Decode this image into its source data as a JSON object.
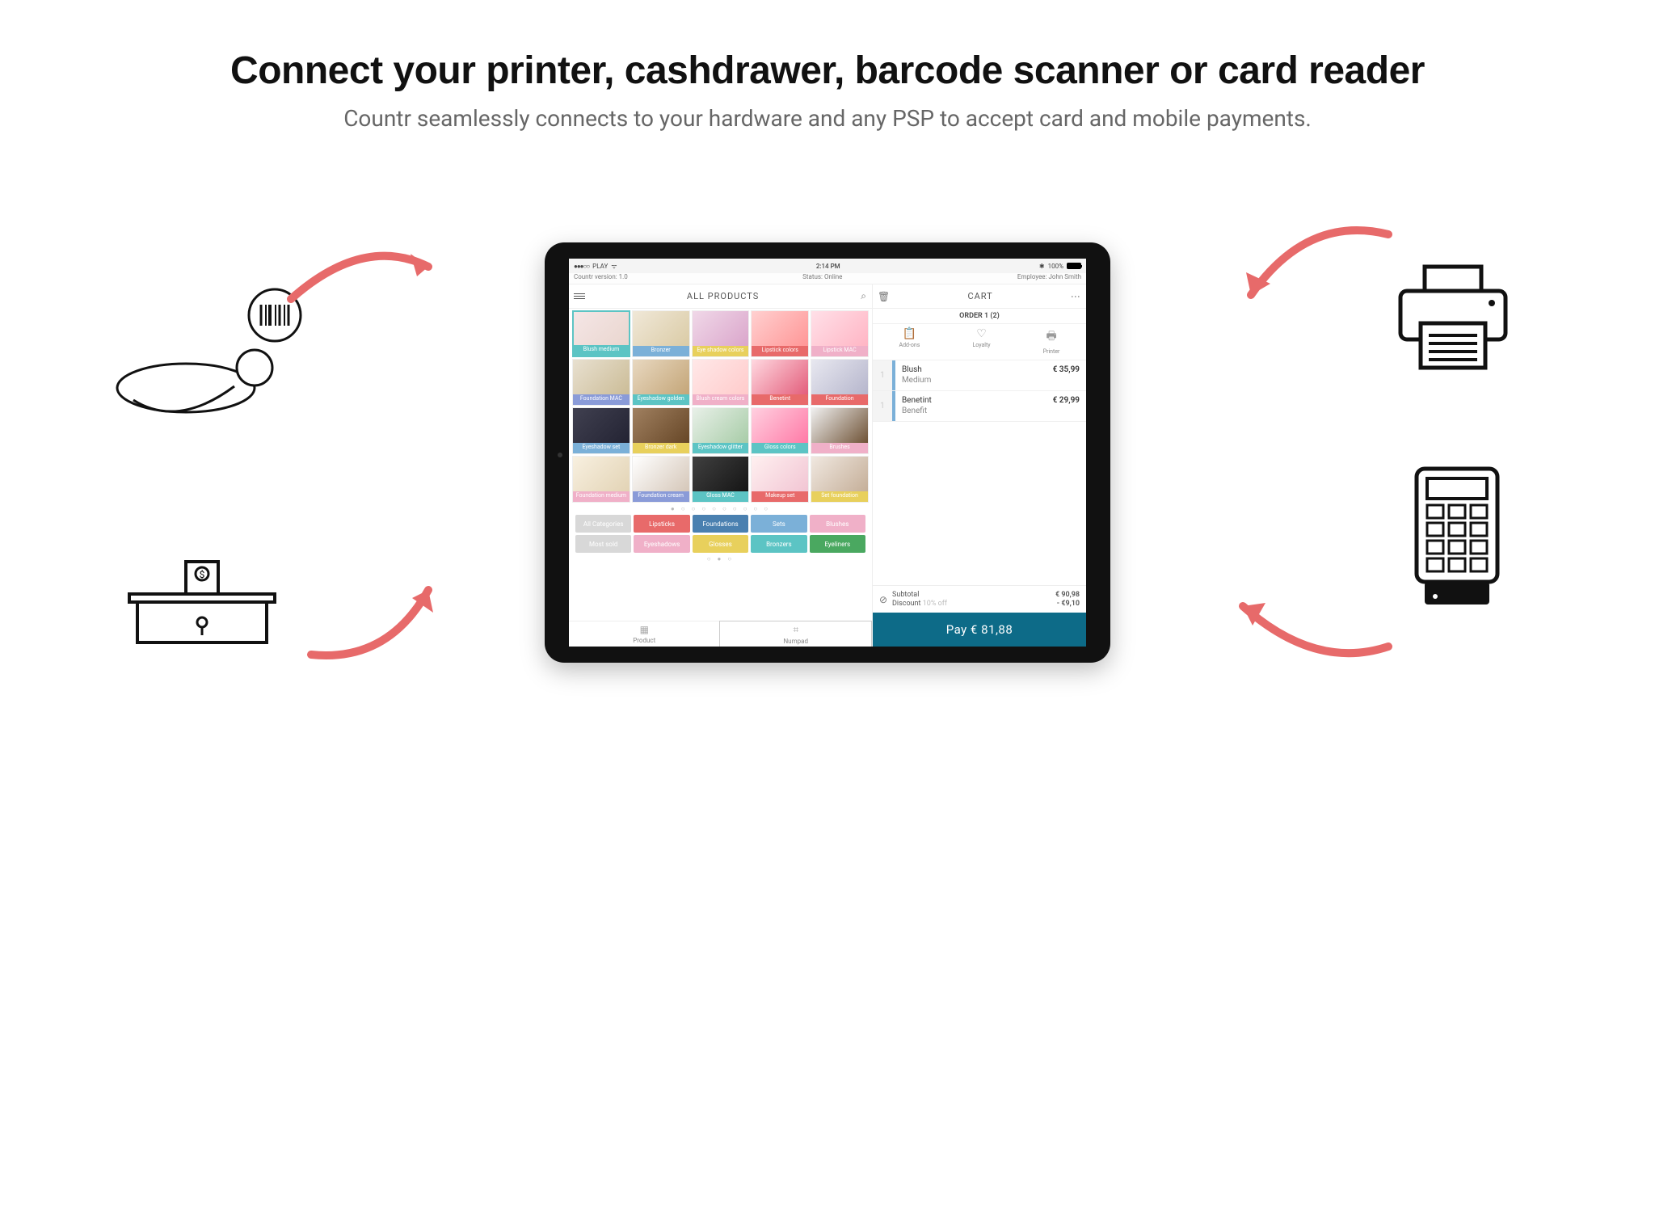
{
  "page": {
    "title": "Connect your printer, cashdrawer, barcode scanner or card reader",
    "subtitle": "Countr seamlessly connects to your hardware and any PSP to accept card and mobile payments."
  },
  "status_bar": {
    "carrier_dots": "●●●○○",
    "carrier": "PLAY",
    "time": "2:14 PM",
    "bluetooth": "✱",
    "battery_pct": "100%"
  },
  "info_bar": {
    "version": "Countr version: 1.0",
    "status": "Status: Online",
    "employee": "Employee: John Smith"
  },
  "left": {
    "header": "ALL PRODUCTS",
    "pager_dots": "● ○ ○ ○ ○ ○ ○ ○ ○ ○",
    "cat_dots": "○ ● ○"
  },
  "products": [
    {
      "name": "Blush medium",
      "color": "#5cc4c4",
      "img": "p1",
      "selected": true
    },
    {
      "name": "Bronzer",
      "color": "#7bb0d8",
      "img": "p2"
    },
    {
      "name": "Eye shadow colors",
      "color": "#e8d05c",
      "img": "p3"
    },
    {
      "name": "Lipstick colors",
      "color": "#e86a6a",
      "img": "p4"
    },
    {
      "name": "Lipstick MAC",
      "color": "#f0b0c8",
      "img": "p5"
    },
    {
      "name": "Foundation MAC",
      "color": "#8a9bd8",
      "img": "p6"
    },
    {
      "name": "Eyeshadow golden",
      "color": "#5cc4c4",
      "img": "p7"
    },
    {
      "name": "Blush cream colors",
      "color": "#f0b0c8",
      "img": "p8"
    },
    {
      "name": "Benetint",
      "color": "#e86a6a",
      "img": "p9"
    },
    {
      "name": "Foundation",
      "color": "#e86a6a",
      "img": "p10"
    },
    {
      "name": "Eyeshadow set",
      "color": "#7bb0d8",
      "img": "p11"
    },
    {
      "name": "Bronzer dark",
      "color": "#e8d05c",
      "img": "p12"
    },
    {
      "name": "Eyeshadow glitter",
      "color": "#5cc4c4",
      "img": "p13"
    },
    {
      "name": "Gloss colors",
      "color": "#5cc4c4",
      "img": "p14"
    },
    {
      "name": "Brushes",
      "color": "#f0b0c8",
      "img": "p15"
    },
    {
      "name": "Foundation medium",
      "color": "#f0b0c8",
      "img": "p16"
    },
    {
      "name": "Foundation cream",
      "color": "#8a9bd8",
      "img": "p17"
    },
    {
      "name": "Gloss MAC",
      "color": "#5cc4c4",
      "img": "p18"
    },
    {
      "name": "Makeup set",
      "color": "#e86a6a",
      "img": "p19"
    },
    {
      "name": "Set foundation",
      "color": "#e8d05c",
      "img": "p20"
    }
  ],
  "categories": [
    {
      "name": "All Categories",
      "color": "#d8d8d8"
    },
    {
      "name": "Lipsticks",
      "color": "#e86a6a"
    },
    {
      "name": "Foundations",
      "color": "#4a80b0"
    },
    {
      "name": "Sets",
      "color": "#7bb0d8"
    },
    {
      "name": "Blushes",
      "color": "#f0b0c8"
    },
    {
      "name": "Most sold",
      "color": "#d8d8d8"
    },
    {
      "name": "Eyeshadows",
      "color": "#f0b0c8"
    },
    {
      "name": "Glosses",
      "color": "#e8d05c"
    },
    {
      "name": "Bronzers",
      "color": "#5cc4c4"
    },
    {
      "name": "Eyeliners",
      "color": "#4aa860"
    }
  ],
  "tabs": {
    "product": "Product",
    "numpad": "Numpad"
  },
  "right": {
    "header": "CART",
    "order": "ORDER 1 (2)",
    "actions": [
      {
        "label": "Add-ons",
        "icon": "📋"
      },
      {
        "label": "Loyalty",
        "icon": "♡"
      },
      {
        "label": "Printer",
        "icon": "🖶"
      }
    ]
  },
  "cart_items": [
    {
      "qty": "1",
      "name": "Blush",
      "variant": "Medium",
      "price": "€ 35,99"
    },
    {
      "qty": "1",
      "name": "Benetint",
      "variant": "Benefit",
      "price": "€ 29,99"
    }
  ],
  "totals": {
    "subtotal_label": "Subtotal",
    "discount_label": "Discount",
    "discount_note": "10% off",
    "subtotal": "€ 90,98",
    "discount": "- €9,10"
  },
  "pay": {
    "label": "Pay  €  81,88"
  },
  "colors": {
    "accent_red": "#e76a6a",
    "pay_bg": "#0d6b88"
  }
}
